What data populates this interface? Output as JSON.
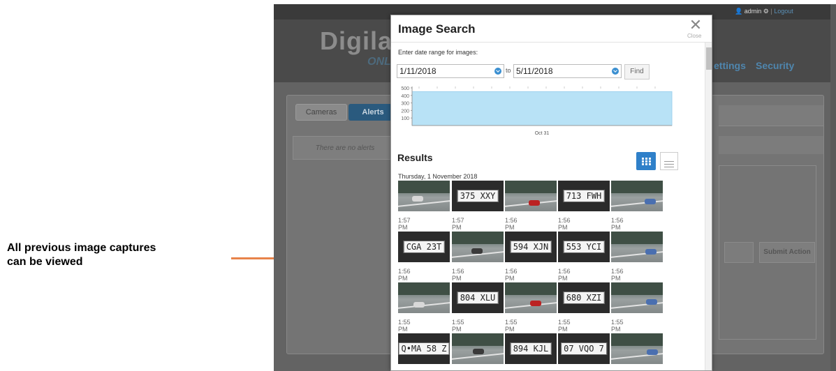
{
  "annotation": {
    "text_line1": "All previous image captures",
    "text_line2": "can be viewed"
  },
  "app": {
    "user": "admin",
    "logout": "Logout",
    "logo": "Digila",
    "logo_sub": "ONL",
    "nav": [
      "ettings",
      "Security"
    ],
    "tabs": [
      "Cameras",
      "Alerts"
    ],
    "no_alerts": "There are no alerts",
    "submit_action": "Submit Action"
  },
  "modal": {
    "title": "Image Search",
    "close_label": "Close",
    "date_prompt": "Enter date range for images:",
    "date_from": "1/11/2018",
    "date_to_label": "to",
    "date_to": "5/11/2018",
    "find_label": "Find",
    "results_title": "Results",
    "day_heading": "Thursday, 1 November 2018",
    "view_icons": [
      "grid-view-icon",
      "list-view-icon"
    ]
  },
  "chart_data": {
    "type": "area",
    "y_ticks": [
      "500",
      "400",
      "300",
      "200",
      "100"
    ],
    "x_tick_labels": [
      "Oct 31"
    ],
    "series": [
      {
        "values": [
          450,
          450
        ]
      }
    ],
    "ylim": [
      0,
      500
    ],
    "fill_color": "#b8e2f6"
  },
  "thumbnails": [
    {
      "kind": "road",
      "plate": "",
      "time": "1:57 PM"
    },
    {
      "kind": "plate",
      "plate": "375 XXY",
      "time": "1:57 PM"
    },
    {
      "kind": "road",
      "plate": "",
      "time": "1:56 PM"
    },
    {
      "kind": "plate",
      "plate": "713 FWH",
      "time": "1:56 PM"
    },
    {
      "kind": "road",
      "plate": "",
      "time": "1:56 PM"
    },
    {
      "kind": "plate",
      "plate": "CGA 23T",
      "time": "1:56 PM"
    },
    {
      "kind": "road",
      "plate": "",
      "time": "1:56 PM"
    },
    {
      "kind": "plate",
      "plate": "594 XJN",
      "time": "1:56 PM"
    },
    {
      "kind": "plate",
      "plate": "553 YCI",
      "time": "1:56 PM"
    },
    {
      "kind": "road",
      "plate": "",
      "time": "1:56 PM"
    },
    {
      "kind": "road",
      "plate": "",
      "time": "1:55 PM"
    },
    {
      "kind": "plate",
      "plate": "804 XLU",
      "time": "1:55 PM"
    },
    {
      "kind": "road",
      "plate": "",
      "time": "1:55 PM"
    },
    {
      "kind": "plate",
      "plate": "680 XZI",
      "time": "1:55 PM"
    },
    {
      "kind": "road",
      "plate": "",
      "time": "1:55 PM"
    },
    {
      "kind": "plate",
      "plate": "Q•MA 58 Z",
      "time": ""
    },
    {
      "kind": "road",
      "plate": "",
      "time": ""
    },
    {
      "kind": "plate",
      "plate": "894 KJL",
      "time": ""
    },
    {
      "kind": "plate",
      "plate": "07 VQO 7",
      "time": ""
    },
    {
      "kind": "road",
      "plate": "",
      "time": ""
    }
  ]
}
